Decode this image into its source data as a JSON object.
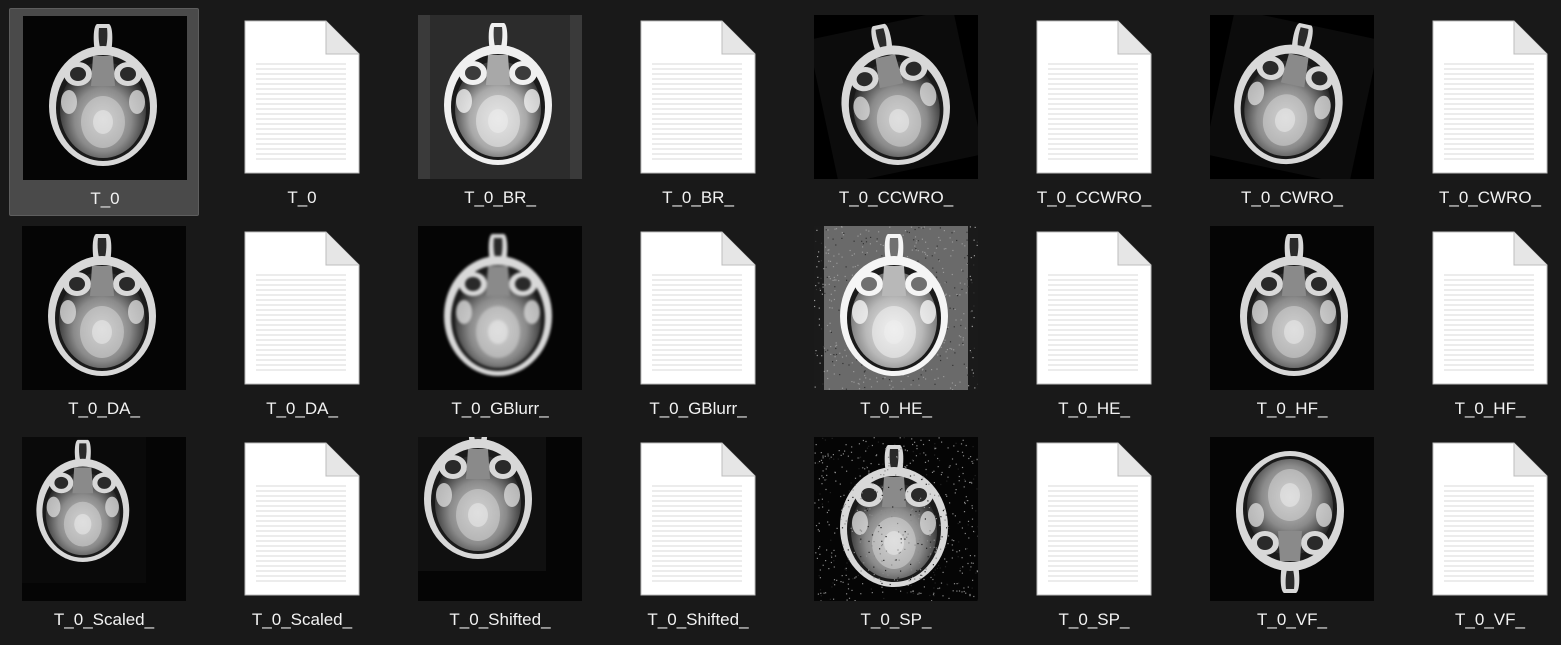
{
  "window": {
    "view": "Large icons",
    "theme": "dark"
  },
  "items": [
    {
      "name": "T_0",
      "kind": "image",
      "variant": "base",
      "selected": true
    },
    {
      "name": "T_0",
      "kind": "document",
      "selected": false
    },
    {
      "name": "T_0_BR_",
      "kind": "image",
      "variant": "bright",
      "selected": false
    },
    {
      "name": "T_0_BR_",
      "kind": "document",
      "selected": false
    },
    {
      "name": "T_0_CCWRO_",
      "kind": "image",
      "variant": "rot-ccw",
      "selected": false
    },
    {
      "name": "T_0_CCWRO_",
      "kind": "document",
      "selected": false
    },
    {
      "name": "T_0_CWRO_",
      "kind": "image",
      "variant": "rot-cw",
      "selected": false
    },
    {
      "name": "T_0_CWRO_",
      "kind": "document",
      "selected": false
    },
    {
      "name": "T_0_DA_",
      "kind": "image",
      "variant": "base",
      "selected": false
    },
    {
      "name": "T_0_DA_",
      "kind": "document",
      "selected": false
    },
    {
      "name": "T_0_GBlurr_",
      "kind": "image",
      "variant": "blur",
      "selected": false
    },
    {
      "name": "T_0_GBlurr_",
      "kind": "document",
      "selected": false
    },
    {
      "name": "T_0_HE_",
      "kind": "image",
      "variant": "equalized",
      "selected": false
    },
    {
      "name": "T_0_HE_",
      "kind": "document",
      "selected": false
    },
    {
      "name": "T_0_HF_",
      "kind": "image",
      "variant": "hflip",
      "selected": false
    },
    {
      "name": "T_0_HF_",
      "kind": "document",
      "selected": false
    },
    {
      "name": "T_0_Scaled_",
      "kind": "image",
      "variant": "scaled",
      "selected": false
    },
    {
      "name": "T_0_Scaled_",
      "kind": "document",
      "selected": false
    },
    {
      "name": "T_0_Shifted_",
      "kind": "image",
      "variant": "shifted",
      "selected": false
    },
    {
      "name": "T_0_Shifted_",
      "kind": "document",
      "selected": false
    },
    {
      "name": "T_0_SP_",
      "kind": "image",
      "variant": "saltpepper",
      "selected": false
    },
    {
      "name": "T_0_SP_",
      "kind": "document",
      "selected": false
    },
    {
      "name": "T_0_VF_",
      "kind": "image",
      "variant": "vflip",
      "selected": false
    },
    {
      "name": "T_0_VF_",
      "kind": "document",
      "selected": false
    }
  ],
  "colors": {
    "background": "#191919",
    "selection": "#4a4a4a",
    "label": "#f2f2f2",
    "document": "#ffffff"
  }
}
